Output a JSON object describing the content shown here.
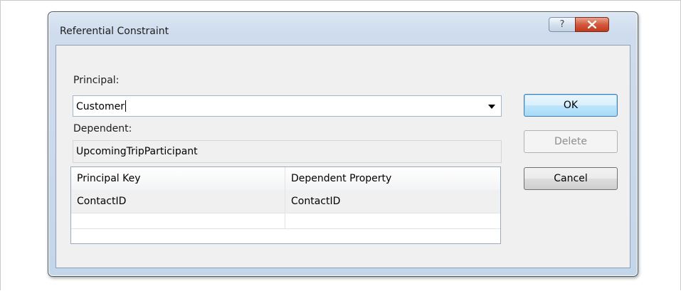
{
  "dialog": {
    "title": "Referential Constraint",
    "help_glyph": "?",
    "principal_label": "Principal:",
    "principal_value": "Customer",
    "dependent_label": "Dependent:",
    "dependent_value": "UpcomingTripParticipant",
    "icons": {
      "help": "help-icon",
      "close": "close-icon",
      "dropdown": "chevron-down-icon"
    }
  },
  "buttons": {
    "ok": "OK",
    "delete": "Delete",
    "cancel": "Cancel"
  },
  "grid": {
    "columns": [
      "Principal Key",
      "Dependent Property"
    ],
    "rows": [
      [
        "ContactID",
        "ContactID"
      ],
      [
        "",
        ""
      ]
    ]
  },
  "colors": {
    "close_button": "#c13a1e",
    "default_button_border": "#3c7fb1",
    "window_frame": "#cfdced"
  }
}
